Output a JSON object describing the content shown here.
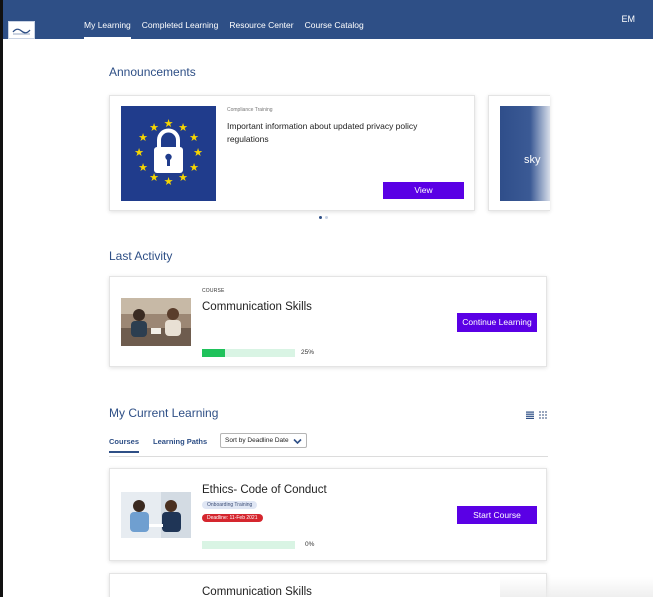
{
  "nav": {
    "items": [
      "My Learning",
      "Completed Learning",
      "Resource Center",
      "Course Catalog"
    ],
    "active_index": 0,
    "user_initials": "EM"
  },
  "announcements": {
    "title": "Announcements",
    "cards": [
      {
        "category": "Compliance Training",
        "text": "Important information about updated privacy policy regulations",
        "button_label": "View",
        "image_icon": "lock-icon-eu-flag"
      },
      {
        "image_text": "sky"
      }
    ],
    "pager_active_index": 0
  },
  "last_activity": {
    "title": "Last Activity",
    "type": "COURSE",
    "course_title": "Communication Skills",
    "progress": 0.25,
    "progress_text": "25%",
    "button_label": "Continue Learning"
  },
  "current_learning": {
    "title": "My Current Learning",
    "tabs": [
      "Courses",
      "Learning Paths"
    ],
    "active_tab": 0,
    "sort_label": "Sort by Deadline Date",
    "view_icons": [
      "list-view-icon",
      "grid-view-icon"
    ],
    "items": [
      {
        "title": "Ethics- Code of Conduct",
        "tag": "Onboarding Training",
        "deadline": "Deadline: 11-Feb 2021",
        "progress": 0,
        "progress_text": "0%",
        "button_label": "Start Course"
      },
      {
        "title": "Communication Skills"
      }
    ]
  },
  "colors": {
    "brand": "#2e4f86",
    "accent": "#5a00e5",
    "progress": "#1fc25b",
    "deadline": "#d5262e"
  }
}
